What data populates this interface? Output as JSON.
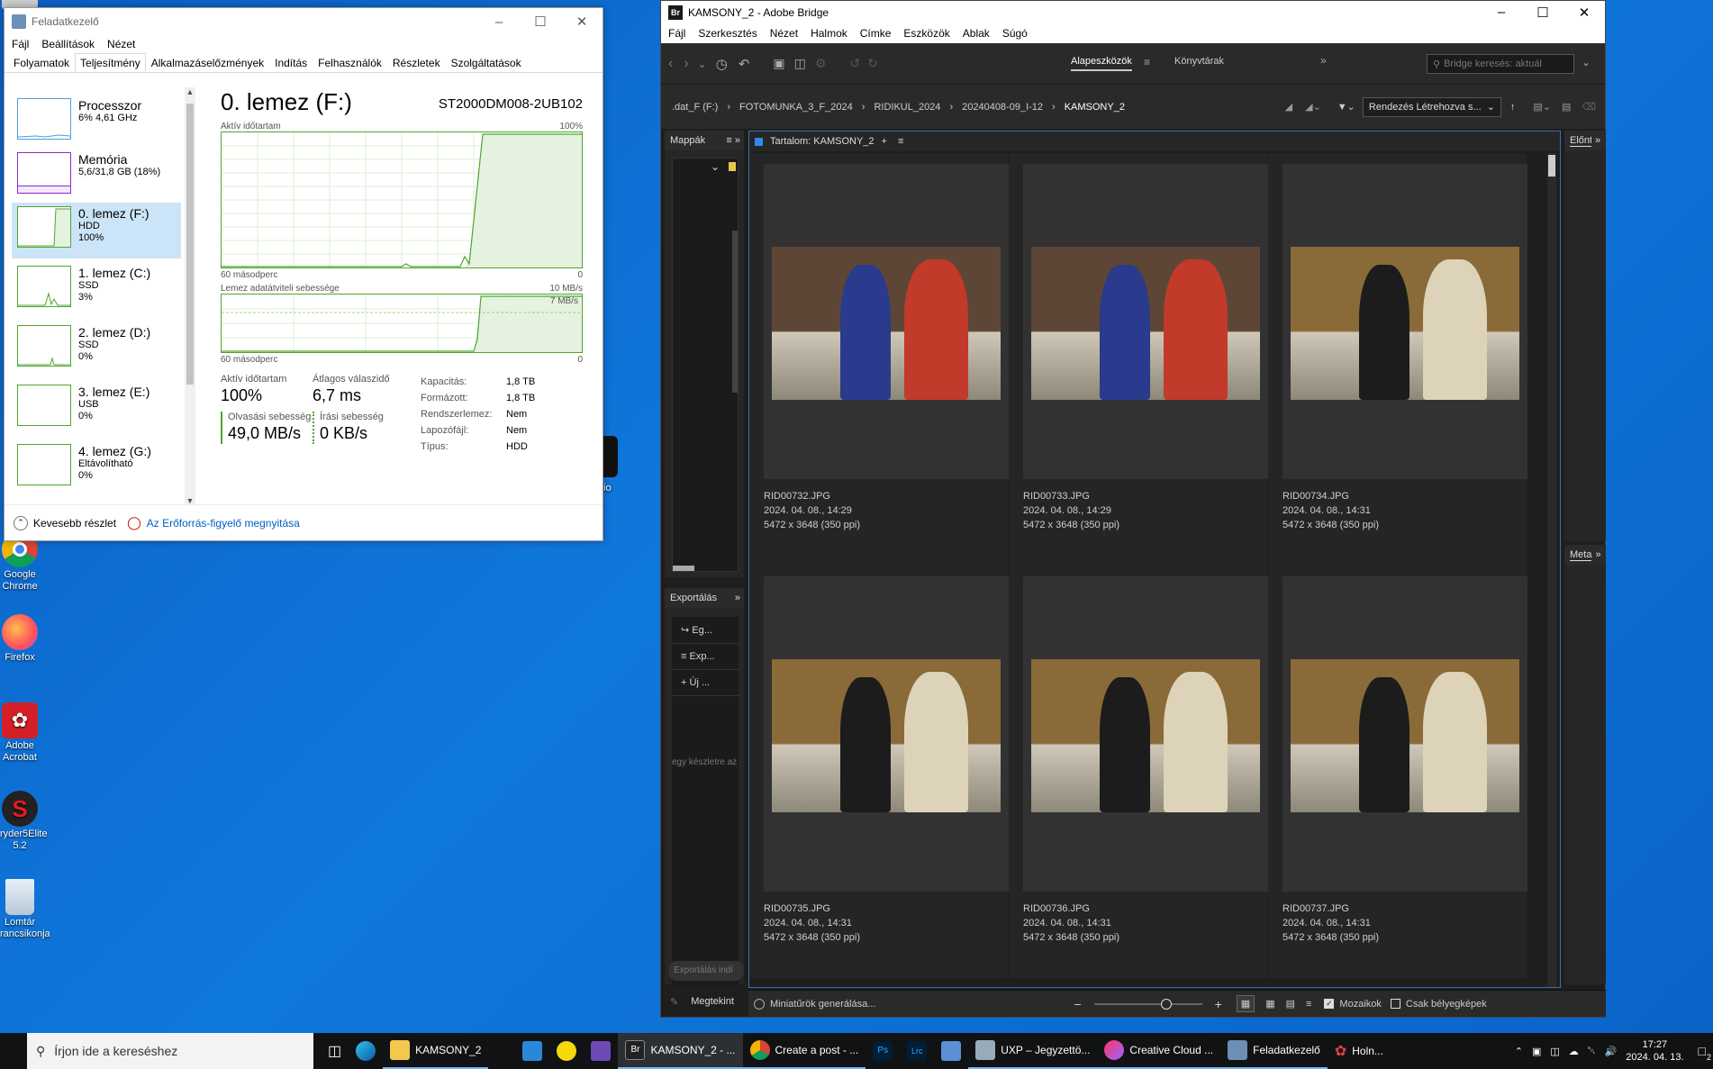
{
  "desktop": {
    "icons": [
      {
        "label": "Google Chrome"
      },
      {
        "label": "Firefox"
      },
      {
        "label": "Adobe Acrobat"
      },
      {
        "label": "ryder5Elite 5.2"
      },
      {
        "label": "Lomtár rancsikonja"
      }
    ],
    "partial_icon_label": "dio"
  },
  "task_manager": {
    "title": "Feladatkezelő",
    "menu": [
      "Fájl",
      "Beállítások",
      "Nézet"
    ],
    "tabs": [
      "Folyamatok",
      "Teljesítmény",
      "Alkalmazáselőzmények",
      "Indítás",
      "Felhasználók",
      "Részletek",
      "Szolgáltatások"
    ],
    "sidebar": [
      {
        "name": "Processzor",
        "sub1": "6% 4,61 GHz",
        "sub2": ""
      },
      {
        "name": "Memória",
        "sub1": "5,6/31,8 GB (18%)",
        "sub2": ""
      },
      {
        "name": "0. lemez (F:)",
        "sub1": "HDD",
        "sub2": "100%"
      },
      {
        "name": "1. lemez (C:)",
        "sub1": "SSD",
        "sub2": "3%"
      },
      {
        "name": "2. lemez (D:)",
        "sub1": "SSD",
        "sub2": "0%"
      },
      {
        "name": "3. lemez (E:)",
        "sub1": "USB",
        "sub2": "0%"
      },
      {
        "name": "4. lemez (G:)",
        "sub1": "Eltávolítható",
        "sub2": "0%"
      }
    ],
    "main": {
      "title": "0. lemez (F:)",
      "model": "ST2000DM008-2UB102",
      "graph1_label": "Aktív időtartam",
      "graph1_max": "100%",
      "graph1_time": "60 másodperc",
      "graph1_min": "0",
      "graph2_label": "Lemez adatátviteli sebessége",
      "graph2_max": "10 MB/s",
      "graph2_inner": "7 MB/s",
      "graph2_time": "60 másodperc",
      "graph2_min": "0",
      "active_label": "Aktív időtartam",
      "active_value": "100%",
      "resp_label": "Átlagos válaszidő",
      "resp_value": "6,7 ms",
      "read_label": "Olvasási sebesség",
      "read_value": "49,0 MB/s",
      "write_label": "Írási sebesség",
      "write_value": "0 KB/s",
      "props": [
        {
          "k": "Kapacitás:",
          "v": "1,8 TB"
        },
        {
          "k": "Formázott:",
          "v": "1,8 TB"
        },
        {
          "k": "Rendszerlemez:",
          "v": "Nem"
        },
        {
          "k": "Lapozófájl:",
          "v": "Nem"
        },
        {
          "k": "Típus:",
          "v": "HDD"
        }
      ]
    },
    "footer": {
      "less": "Kevesebb részlet",
      "link": "Az Erőforrás-figyelő megnyitása"
    }
  },
  "bridge": {
    "title": "KAMSONY_2 - Adobe Bridge",
    "menu": [
      "Fájl",
      "Szerkesztés",
      "Nézet",
      "Halmok",
      "Címke",
      "Eszközök",
      "Ablak",
      "Súgó"
    ],
    "workspaces": [
      "Alapeszközök",
      "Könyvtárak"
    ],
    "search_placeholder": "Bridge keresés: aktuál",
    "path": [
      ".dat_F (F:)",
      "FOTOMUNKA_3_F_2024",
      "RIDIKUL_2024",
      "20240408-09_I-12",
      "KAMSONY_2"
    ],
    "sort_label": "Rendezés Létrehozva s...",
    "folders_panel": "Mappák",
    "content_panel": "Tartalom: KAMSONY_2",
    "export_panel": "Exportálás",
    "export_items": [
      "Eg...",
      "Exp...",
      "Új ..."
    ],
    "export_hint": "egy készletre az",
    "export_footer": "Exportálás indí",
    "preview_panel": "Előnt",
    "meta_panel": "Meta",
    "status_left": "Miniatűrök generálása...",
    "view_label": "Megtekint",
    "tiles_label": "Mozaikok",
    "thumbs_only_label": "Csak bélyegképek",
    "items": [
      {
        "name": "RID00732.JPG",
        "date": "2024. 04. 08., 14:29",
        "dims": "5472 x 3648 (350 ppi)"
      },
      {
        "name": "RID00733.JPG",
        "date": "2024. 04. 08., 14:29",
        "dims": "5472 x 3648 (350 ppi)"
      },
      {
        "name": "RID00734.JPG",
        "date": "2024. 04. 08., 14:31",
        "dims": "5472 x 3648 (350 ppi)"
      },
      {
        "name": "RID00735.JPG",
        "date": "2024. 04. 08., 14:31",
        "dims": "5472 x 3648 (350 ppi)"
      },
      {
        "name": "RID00736.JPG",
        "date": "2024. 04. 08., 14:31",
        "dims": "5472 x 3648 (350 ppi)"
      },
      {
        "name": "RID00737.JPG",
        "date": "2024. 04. 08., 14:31",
        "dims": "5472 x 3648 (350 ppi)"
      }
    ]
  },
  "taskbar": {
    "search_placeholder": "Írjon ide a kereséshez",
    "apps": [
      {
        "label": "KAMSONY_2"
      },
      {
        "label": "KAMSONY_2 - ..."
      },
      {
        "label": "Create a post - ..."
      },
      {
        "label": "UXP – Jegyzettö..."
      },
      {
        "label": "Creative Cloud ..."
      },
      {
        "label": "Feladatkezelő"
      },
      {
        "label": "Holn..."
      }
    ],
    "ps_label": "Ps",
    "lrc_label": "Lrc",
    "time": "17:27",
    "date": "2024. 04. 13.",
    "notif_count": "2"
  },
  "colors": {
    "disk_green": "#4ea72e",
    "cpu_blue": "#4a9fd8",
    "mem_purple": "#8b2dbc",
    "bridge_bg": "#1e1e1e"
  }
}
